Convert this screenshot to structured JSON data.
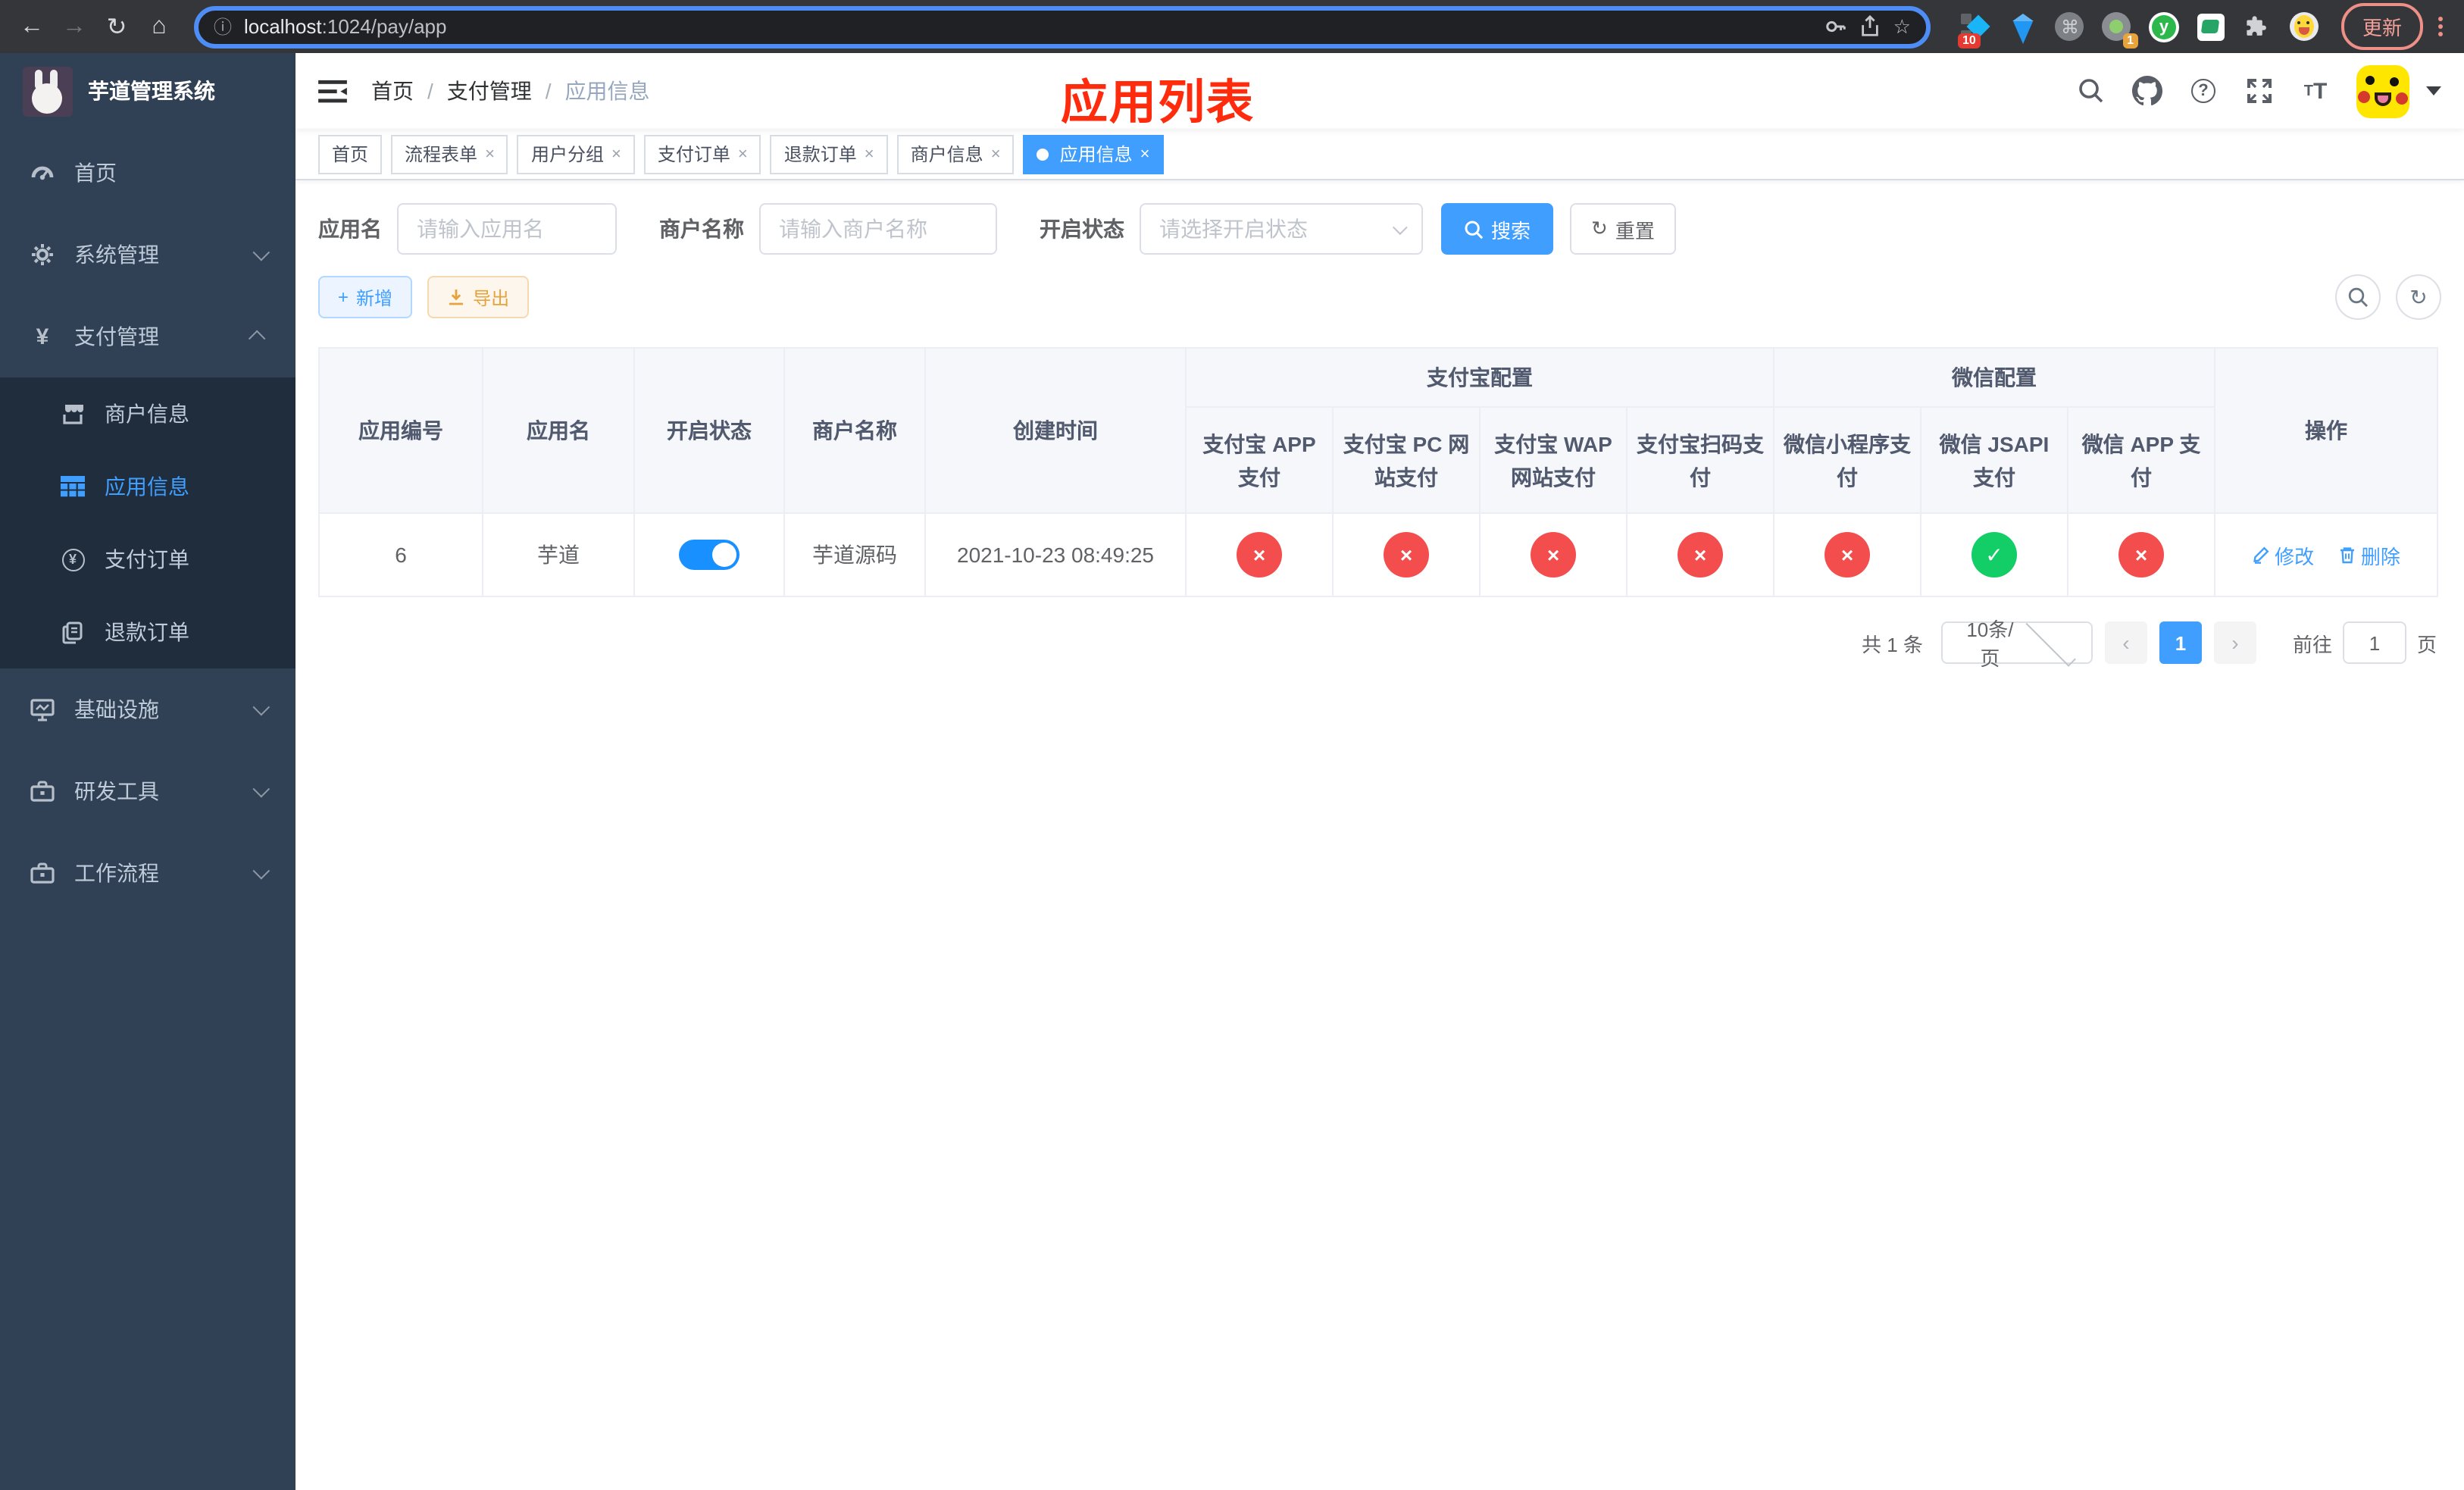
{
  "browser": {
    "url_host": "localhost",
    "url_path": ":1024/pay/app",
    "update_button": "更新",
    "ext_badge_blue": "10",
    "ext_badge_orange": "1",
    "ext_y_letter": "y"
  },
  "icons": {
    "back": "←",
    "forward": "→",
    "reload": "↻",
    "home": "⌂",
    "info": "ⓘ",
    "star": "☆",
    "command": "⌘",
    "question": "?",
    "plus": "+",
    "refresh": "↻",
    "close": "×",
    "check": "✓",
    "cross": "×",
    "yen": "¥",
    "prev": "‹",
    "next": "›",
    "font_large": "T",
    "font_small": "T"
  },
  "sidebar": {
    "title": "芋道管理系统",
    "items": {
      "home": "首页",
      "system": "系统管理",
      "pay": "支付管理",
      "merchant": "商户信息",
      "appinfo": "应用信息",
      "payorder": "支付订单",
      "refund": "退款订单",
      "infra": "基础设施",
      "devtool": "研发工具",
      "workflow": "工作流程"
    }
  },
  "header": {
    "breadcrumb": {
      "home": "首页",
      "pay": "支付管理",
      "current": "应用信息"
    },
    "separator": "/",
    "overlay_title": "应用列表"
  },
  "tabs": {
    "t0": "首页",
    "t1": "流程表单",
    "t2": "用户分组",
    "t3": "支付订单",
    "t4": "退款订单",
    "t5": "商户信息",
    "t6": "应用信息"
  },
  "filters": {
    "app_name_label": "应用名",
    "app_name_placeholder": "请输入应用名",
    "merchant_label": "商户名称",
    "merchant_placeholder": "请输入商户名称",
    "status_label": "开启状态",
    "status_placeholder": "请选择开启状态",
    "search_button": "搜索",
    "reset_button": "重置"
  },
  "toolbar": {
    "add_button": "新增",
    "export_button": "导出"
  },
  "table": {
    "group_headers": {
      "alipay": "支付宝配置",
      "wechat": "微信配置"
    },
    "columns": [
      "应用编号",
      "应用名",
      "开启状态",
      "商户名称",
      "创建时间",
      "支付宝 APP 支付",
      "支付宝 PC 网站支付",
      "支付宝 WAP 网站支付",
      "支付宝扫码支付",
      "微信小程序支付",
      "微信 JSAPI 支付",
      "微信 APP 支付",
      "操作"
    ],
    "row": {
      "id": "6",
      "name": "芋道",
      "enabled": true,
      "merchant": "芋道源码",
      "created_at": "2021-10-23 08:49:25",
      "configs": [
        false,
        false,
        false,
        false,
        false,
        true,
        false
      ]
    },
    "actions": {
      "edit": "修改",
      "delete": "删除"
    }
  },
  "pagination": {
    "total_text": "共 1 条",
    "page_size": "10条/页",
    "current_page": "1",
    "goto_label": "前往",
    "goto_value": "1",
    "page_label": "页"
  }
}
